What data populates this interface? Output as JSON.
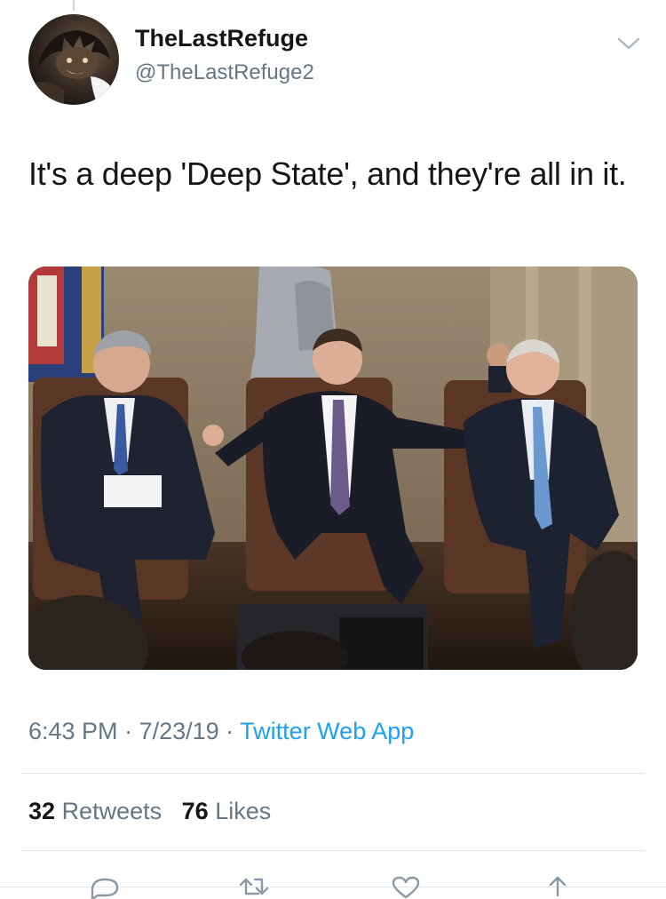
{
  "author": {
    "display_name": "TheLastRefuge",
    "handle": "@TheLastRefuge2",
    "avatar_icon": "wolverine-avatar-icon"
  },
  "tweet": {
    "text": "It's a deep 'Deep State', and they're all in it."
  },
  "meta": {
    "time": "6:43 PM",
    "separator": " · ",
    "date": "7/23/19",
    "source": "Twitter Web App"
  },
  "stats": {
    "retweets_count": "32",
    "retweets_label": "Retweets",
    "likes_count": "76",
    "likes_label": "Likes"
  },
  "actions": [
    "reply-icon",
    "retweet-icon",
    "like-icon",
    "share-icon"
  ],
  "colors": {
    "link": "#1da1f2",
    "secondary_text": "#657786",
    "primary_text": "#14171a",
    "divider": "#e1e8ed"
  }
}
